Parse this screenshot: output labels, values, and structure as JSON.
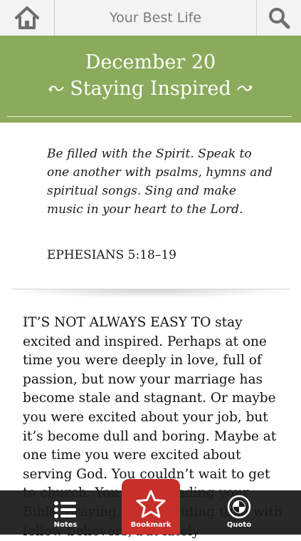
{
  "topbar": {
    "home_icon": "home-icon",
    "title": "Your Best Life",
    "search_icon": "search-icon"
  },
  "header": {
    "date": "December 20",
    "title": "Staying Inspired",
    "accent_color": "#8aab5b"
  },
  "verse": {
    "text": "Be filled with the Spirit. Speak to one another with psalms, hymns and spiritual songs. Sing and make music in your heart to the Lord.",
    "reference": "EPHESIANS 5:18–19"
  },
  "body": {
    "text": "IT’S NOT ALWAYS EASY TO stay excited and inspired. Perhaps at one time you were deeply in love, full of passion, but now your marriage has become stale and stagnant. Or maybe you were excited about your job, but it’s become dull and boring. Maybe at one time you were excited about serving God. You couldn’t wait to get to church. You loved reading your Bible, praying, and spending time with fellow believers, but lately"
  },
  "toolbar": {
    "notes_label": "Notes",
    "bookmark_label": "Bookmark",
    "quoto_label": "Quoto",
    "bookmark_color": "#c62f2a"
  }
}
